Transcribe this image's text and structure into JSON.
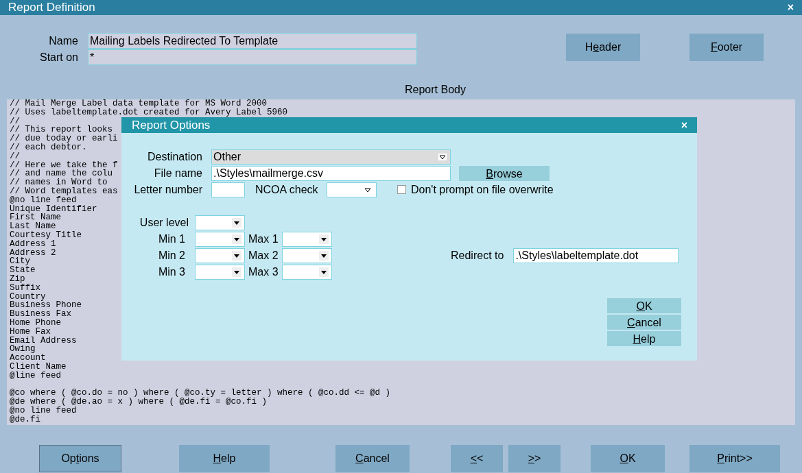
{
  "window": {
    "title": "Report Definition",
    "close": "×"
  },
  "fields": [
    {
      "label": "Name",
      "value": "Mailing Labels Redirected To Template"
    },
    {
      "label": "Start on",
      "value": "*"
    }
  ],
  "top_buttons": [
    {
      "label": {
        "before": "H",
        "key": "e",
        "after": "ader"
      }
    },
    {
      "label": {
        "key": "F",
        "after": "ooter"
      }
    }
  ],
  "report_body": {
    "title": "Report Body",
    "blocks": [
      [
        "// Mail Merge Label data template for MS Word 2000",
        "// Uses labeltemplate.dot created for Avery Label 5960",
        "//",
        "// This report looks",
        "// due today or earli",
        "// each debtor.",
        "//",
        "// Here we take the f",
        "// and name the colu",
        "// names in Word to",
        "// Word templates eas",
        "@no line feed",
        "Unique Identifier",
        "First Name",
        "Last Name",
        "Courtesy Title",
        "Address 1",
        "Address 2",
        "City",
        "State",
        "Zip",
        "Suffix",
        "Country",
        "Business Phone",
        "Business Fax",
        "Home Phone",
        "Home Fax",
        "Email Address",
        "Owing",
        "Account",
        "Client Name",
        "@line feed"
      ],
      [
        "@co where ( @co.do = no ) where ( @co.ty = letter ) where ( @co.dd <= @d )",
        "@de where ( @de.ao = x ) where ( @de.fi = @co.fi )",
        "@no line feed",
        "@de.fi"
      ]
    ]
  },
  "bottom_buttons": [
    {
      "label": {
        "before": "Op",
        "key": "t",
        "after": "ions"
      },
      "focused": true
    },
    {
      "label": {
        "key": "H",
        "after": "elp"
      },
      "focused": false
    },
    {
      "label": {
        "key": "C",
        "after": "ancel"
      },
      "focused": false
    },
    {
      "label": {
        "key": "<",
        "after": "<"
      },
      "focused": false
    },
    {
      "label": {
        "key": ">",
        "after": ">"
      },
      "focused": false
    },
    {
      "label": {
        "key": "O",
        "after": "K"
      },
      "focused": false
    },
    {
      "label": {
        "key": "P",
        "after": "rint>>"
      },
      "focused": false
    }
  ],
  "dialog": {
    "title": "Report Options",
    "close": "×",
    "destination": {
      "label": "Destination",
      "value": "Other"
    },
    "file_name": {
      "label": "File name",
      "value": ".\\Styles\\mailmerge.csv"
    },
    "browse": {
      "label": {
        "key": "B",
        "after": "rowse"
      }
    },
    "letter_number": {
      "label": "Letter number"
    },
    "ncoa_check": {
      "label": "NCOA check"
    },
    "overwrite": {
      "label": "Don't prompt on file overwrite",
      "checked": false
    },
    "user_level": {
      "label": "User level"
    },
    "ranges": [
      {
        "min_label": "Min 1",
        "max_label": "Max 1"
      },
      {
        "min_label": "Min 2",
        "max_label": "Max 2"
      },
      {
        "min_label": "Min 3",
        "max_label": "Max 3"
      }
    ],
    "redirect": {
      "label": "Redirect to",
      "value": ".\\Styles\\labeltemplate.dot"
    },
    "buttons": [
      {
        "label": {
          "key": "O",
          "after": "K"
        }
      },
      {
        "label": {
          "key": "C",
          "after": "ancel"
        }
      },
      {
        "label": {
          "key": "H",
          "after": "elp"
        }
      }
    ]
  }
}
